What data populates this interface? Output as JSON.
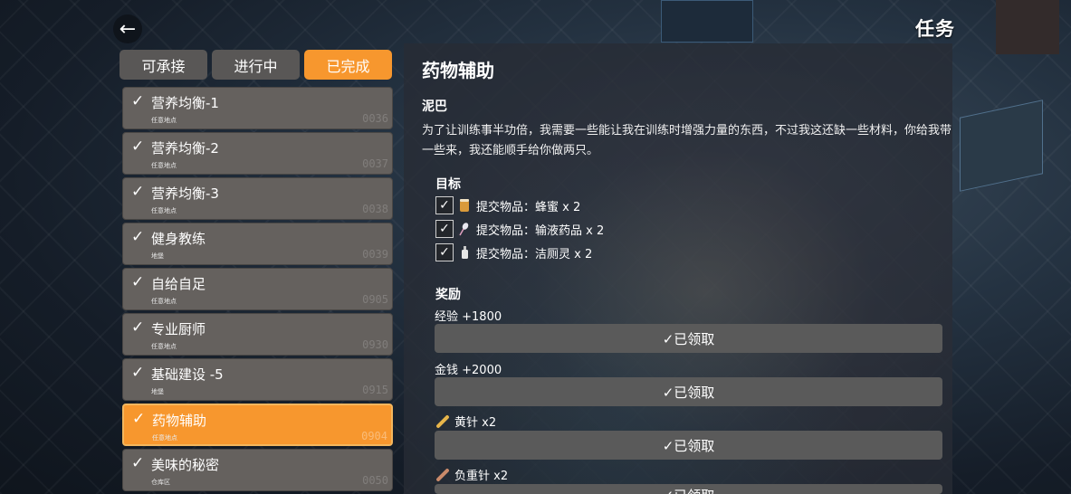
{
  "header": {
    "back_icon": "arrow-left-icon",
    "title": "任务"
  },
  "tabs": [
    {
      "label": "可承接",
      "active": false
    },
    {
      "label": "进行中",
      "active": false
    },
    {
      "label": "已完成",
      "active": true
    }
  ],
  "quests": [
    {
      "name": "营养均衡-1",
      "location": "任意地点",
      "code": "0036",
      "active": false
    },
    {
      "name": "营养均衡-2",
      "location": "任意地点",
      "code": "0037",
      "active": false
    },
    {
      "name": "营养均衡-3",
      "location": "任意地点",
      "code": "0038",
      "active": false
    },
    {
      "name": "健身教练",
      "location": "地堡",
      "code": "0039",
      "active": false
    },
    {
      "name": "自给自足",
      "location": "任意地点",
      "code": "0905",
      "active": false
    },
    {
      "name": "专业厨师",
      "location": "任意地点",
      "code": "0930",
      "active": false
    },
    {
      "name": "基础建设 -5",
      "location": "地堡",
      "code": "0915",
      "active": false
    },
    {
      "name": "药物辅助",
      "location": "任意地点",
      "code": "0904",
      "active": true
    },
    {
      "name": "美味的秘密",
      "location": "仓库区",
      "code": "0050",
      "active": false
    }
  ],
  "detail": {
    "title": "药物辅助",
    "npc": "泥巴",
    "description": "为了让训练事半功倍，我需要一些能让我在训练时增强力量的东西，不过我这还缺一些材料，你给我带一些来，我还能顺手给你做两只。",
    "objectives_label": "目标",
    "objectives": [
      {
        "text": "提交物品：蜂蜜 x 2",
        "icon": "honey-jar-icon",
        "checked": true
      },
      {
        "text": "提交物品：输液药品 x 2",
        "icon": "iv-bag-icon",
        "checked": true
      },
      {
        "text": "提交物品：洁厕灵 x 2",
        "icon": "cleaner-bottle-icon",
        "checked": true
      }
    ],
    "rewards_label": "奖励",
    "rewards": [
      {
        "label": "经验 +1800",
        "icon": "",
        "button": "✓已领取"
      },
      {
        "label": "金钱 +2000",
        "icon": "",
        "button": "✓已领取"
      },
      {
        "label": "黄针 x2",
        "icon": "yellow-needle-icon",
        "button": "✓已领取"
      },
      {
        "label": "负重针 x2",
        "icon": "weight-needle-icon",
        "button": "✓已领取"
      }
    ]
  },
  "colors": {
    "accent": "#f7972e",
    "tab_inactive": "#595756",
    "item_bg": "#65615e"
  }
}
